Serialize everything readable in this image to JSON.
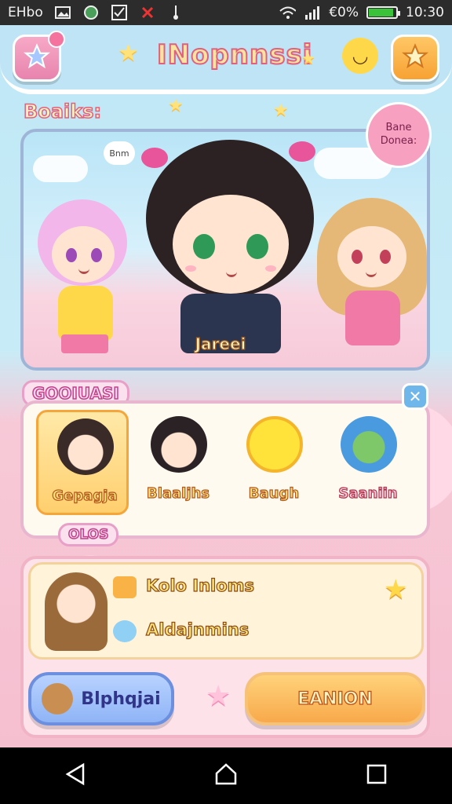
{
  "status_bar": {
    "carrier": "EHbo",
    "battery_percent_text": "€0%",
    "battery_level": 0.9,
    "time": "10:30",
    "icons": [
      "image-icon",
      "globe-icon",
      "checkbox-icon",
      "close-icon",
      "pin-icon",
      "wifi-icon",
      "signal-icon",
      "battery-icon"
    ]
  },
  "header": {
    "title": "INopnnssi",
    "left_button_icon": "star-icon",
    "right_button_icon": "star-icon"
  },
  "hero": {
    "section_label": "Boaiks:",
    "featured_name": "Jareei",
    "bubble_line1": "Bane",
    "bubble_line2": "Donea:",
    "thought_text": "Bnm"
  },
  "friends": {
    "section_label": "GOOIUASI",
    "items": [
      {
        "label": "Gepagja"
      },
      {
        "label": "Blaaljhs"
      },
      {
        "label": "Baugh"
      },
      {
        "label": "Saaniin"
      }
    ],
    "footer_pill": "OLOS"
  },
  "bottom": {
    "rows": [
      {
        "label": "Kolo Inloms"
      },
      {
        "label": "Aldajnmins"
      }
    ],
    "left_button": "Blphqjai",
    "right_button": "EANION"
  },
  "colors": {
    "accent_pink": "#e0607f",
    "accent_orange": "#f8a94b",
    "accent_blue": "#8fb4f6",
    "battery_green": "#39c23a"
  }
}
